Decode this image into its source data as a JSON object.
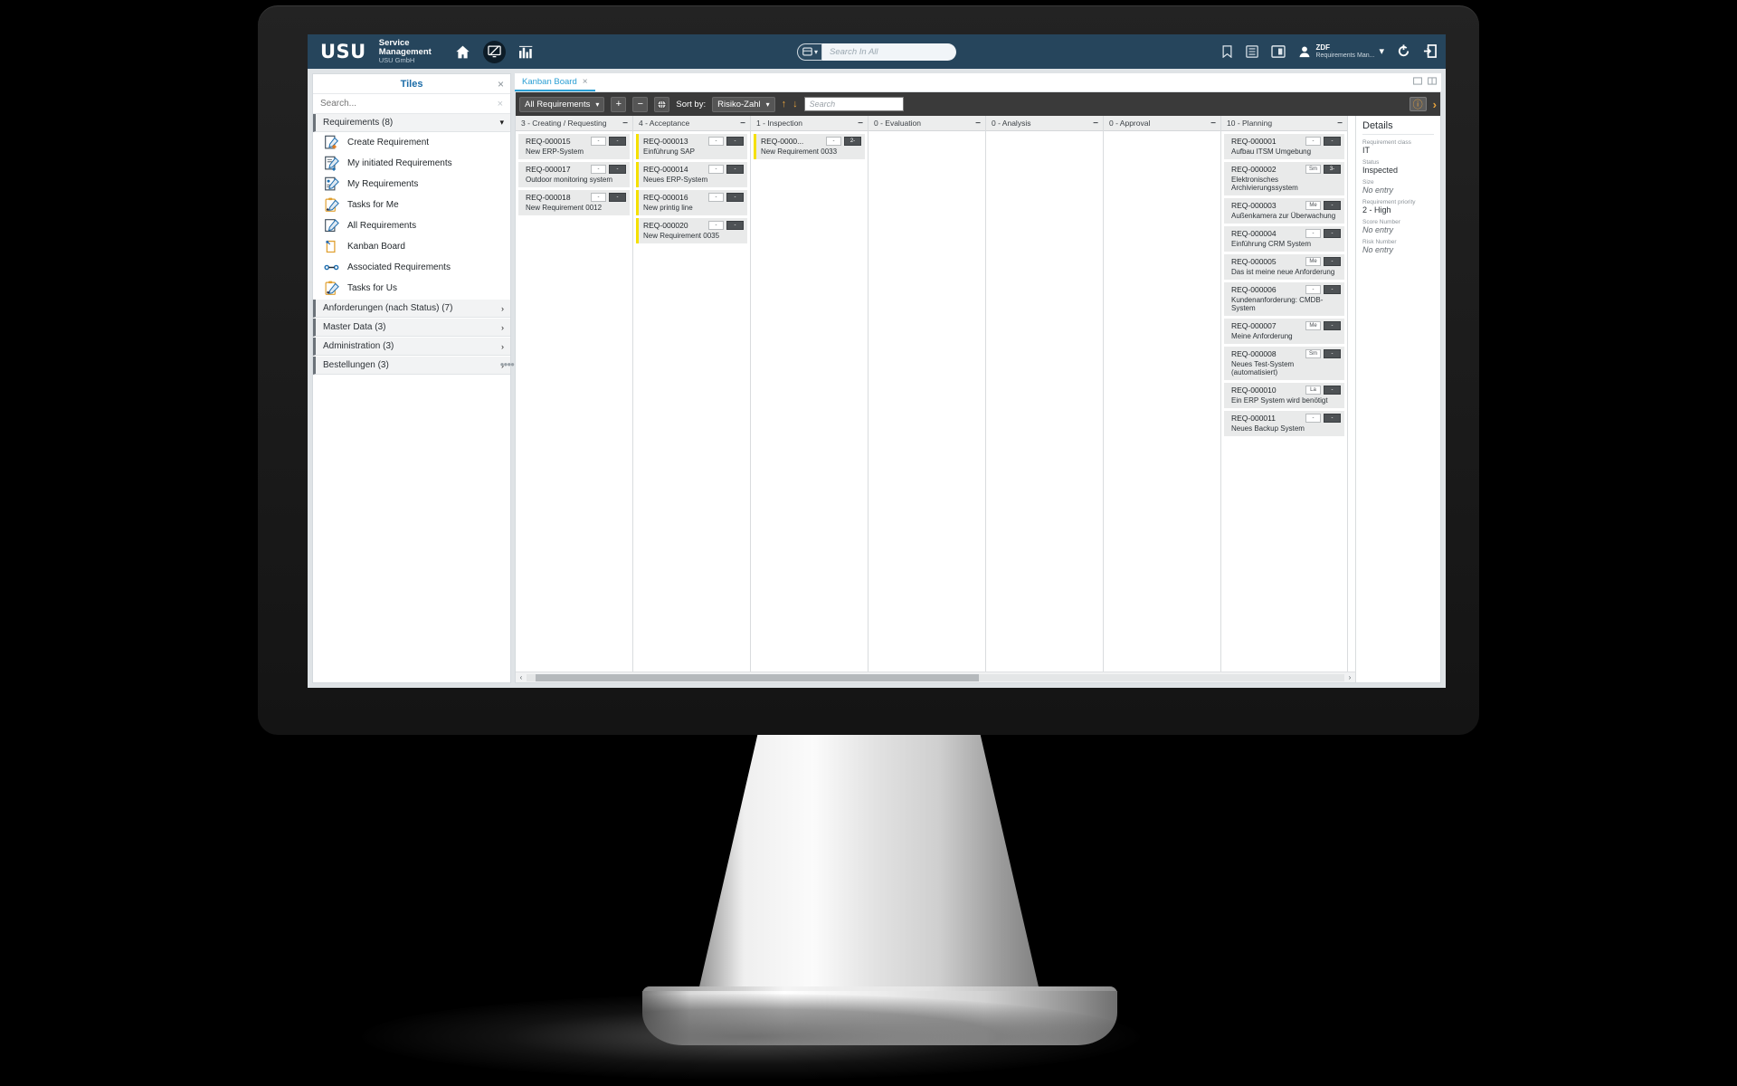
{
  "header": {
    "logo": "USU",
    "brand_line1": "Service",
    "brand_line2": "Management",
    "brand_line3": "USU GmbH",
    "icons": [
      {
        "name": "home-icon",
        "label": "Home"
      },
      {
        "name": "monitor-edit-icon",
        "label": "Workspace"
      },
      {
        "name": "bar-chart-icon",
        "label": "Analytics"
      }
    ],
    "search": {
      "placeholder": "Search In All",
      "value": "",
      "type_selector": "search-scope"
    },
    "right_icons": [
      {
        "name": "bookmark-icon",
        "label": "Bookmarks"
      },
      {
        "name": "list-icon",
        "label": "Lists"
      },
      {
        "name": "id-card-icon",
        "label": "Contact"
      }
    ],
    "user": {
      "name": "ZDF",
      "role": "Requirements Man...",
      "dropdown": "⌄"
    },
    "refresh_icon": "refresh-icon",
    "logout_icon": "logout-icon",
    "accent_color": "#26455c"
  },
  "sidebar": {
    "title": "Tiles",
    "close": "×",
    "search": {
      "placeholder": "Search...",
      "value": "",
      "clear": "×"
    },
    "group": {
      "label": "Requirements (8)",
      "chevron": "⌄"
    },
    "items": [
      {
        "label": "Create Requirement",
        "icon": "create-requirement-icon"
      },
      {
        "label": "My initiated Requirements",
        "icon": "my-initiated-requirements-icon"
      },
      {
        "label": "My Requirements",
        "icon": "my-requirements-icon"
      },
      {
        "label": "Tasks for Me",
        "icon": "tasks-for-me-icon"
      },
      {
        "label": "All Requirements",
        "icon": "all-requirements-icon"
      },
      {
        "label": "Kanban Board",
        "icon": "kanban-board-icon"
      },
      {
        "label": "Associated Requirements",
        "icon": "associated-requirements-icon"
      },
      {
        "label": "Tasks for Us",
        "icon": "tasks-for-us-icon"
      }
    ],
    "groups": [
      {
        "label": "Anforderungen (nach Status) (7)",
        "chevron": "›"
      },
      {
        "label": "Master Data (3)",
        "chevron": "›"
      },
      {
        "label": "Administration (3)",
        "chevron": "›"
      },
      {
        "label": "Bestellungen (3)",
        "chevron": "›"
      }
    ]
  },
  "tabs": [
    {
      "label": "Kanban Board",
      "close": "×",
      "active": true
    }
  ],
  "toolbar": {
    "filter_select": "All Requirements",
    "chevron": "⌄",
    "add_label": "+",
    "remove_label": "−",
    "globe_icon": "globe-icon",
    "sort_label": "Sort by:",
    "sort_select": "Risiko-Zahl",
    "sort_asc": "↑",
    "sort_desc": "↓",
    "search_placeholder": "Search",
    "search_value": "",
    "warning_icon": "warning-icon",
    "expand_chevron": "›",
    "accent_color": "#e8a33d"
  },
  "board": {
    "columns": [
      {
        "title": "3 - Creating / Requesting",
        "collapse": "−",
        "cards": [
          {
            "id": "REQ-000015",
            "title": "New ERP-System",
            "badge_light": "-",
            "badge_dark": "-",
            "highlight": false
          },
          {
            "id": "REQ-000017",
            "title": "Outdoor monitoring system",
            "badge_light": "-",
            "badge_dark": "-",
            "highlight": false
          },
          {
            "id": "REQ-000018",
            "title": "New Requirement 0012",
            "badge_light": "-",
            "badge_dark": "-",
            "highlight": false
          }
        ]
      },
      {
        "title": "4 - Acceptance",
        "collapse": "−",
        "cards": [
          {
            "id": "REQ-000013",
            "title": "Einführung SAP",
            "badge_light": "-",
            "badge_dark": "-",
            "highlight": true
          },
          {
            "id": "REQ-000014",
            "title": "Neues ERP-System",
            "badge_light": "-",
            "badge_dark": "-",
            "highlight": true
          },
          {
            "id": "REQ-000016",
            "title": "New printig line",
            "badge_light": "-",
            "badge_dark": "-",
            "highlight": true
          },
          {
            "id": "REQ-000020",
            "title": "New Requirement 0035",
            "badge_light": "-",
            "badge_dark": "-",
            "highlight": true
          }
        ]
      },
      {
        "title": "1 - Inspection",
        "collapse": "−",
        "cards": [
          {
            "id": "REQ-0000...",
            "title": "New Requirement 0033",
            "badge_light": "-",
            "badge_dark": "2-",
            "highlight": true
          }
        ]
      },
      {
        "title": "0 - Evaluation",
        "collapse": "−",
        "cards": []
      },
      {
        "title": "0 - Analysis",
        "collapse": "−",
        "cards": []
      },
      {
        "title": "0 - Approval",
        "collapse": "−",
        "cards": []
      },
      {
        "title": "10 - Planning",
        "collapse": "−",
        "cards": [
          {
            "id": "REQ-000001",
            "title": "Aufbau ITSM Umgebung",
            "badge_light": "-",
            "badge_dark": "-",
            "highlight": false
          },
          {
            "id": "REQ-000002",
            "title": "Elektronisches Archivierungssystem",
            "badge_light": "Sm",
            "badge_dark": "3-",
            "highlight": false
          },
          {
            "id": "REQ-000003",
            "title": "Außenkamera zur Überwachung",
            "badge_light": "Me",
            "badge_dark": "-",
            "highlight": false
          },
          {
            "id": "REQ-000004",
            "title": "Einführung CRM System",
            "badge_light": "-",
            "badge_dark": "-",
            "highlight": false
          },
          {
            "id": "REQ-000005",
            "title": "Das ist meine neue Anforderung",
            "badge_light": "Me",
            "badge_dark": "-",
            "highlight": false
          },
          {
            "id": "REQ-000006",
            "title": "Kundenanforderung: CMDB-System",
            "badge_light": "-",
            "badge_dark": "-",
            "highlight": false
          },
          {
            "id": "REQ-000007",
            "title": "Meine Anforderung",
            "badge_light": "Me",
            "badge_dark": "-",
            "highlight": false
          },
          {
            "id": "REQ-000008",
            "title": "Neues Test-System (automatisiert)",
            "badge_light": "Sm",
            "badge_dark": "-",
            "highlight": false
          },
          {
            "id": "REQ-000010",
            "title": "Ein ERP System wird benötigt",
            "badge_light": "La",
            "badge_dark": "-",
            "highlight": false
          },
          {
            "id": "REQ-000011",
            "title": "Neues Backup System",
            "badge_light": "-",
            "badge_dark": "-",
            "highlight": false
          }
        ]
      }
    ],
    "scroll_left": "‹",
    "scroll_right": "›"
  },
  "details": {
    "title": "Details",
    "fields": [
      {
        "label": "Requirement class",
        "value": "IT",
        "empty": false
      },
      {
        "label": "Status",
        "value": "Inspected",
        "empty": false
      },
      {
        "label": "Size",
        "value": "No entry",
        "empty": true
      },
      {
        "label": "Requirement priority",
        "value": "2 - High",
        "empty": false
      },
      {
        "label": "Score Number",
        "value": "No entry",
        "empty": true
      },
      {
        "label": "Risk Number",
        "value": "No entry",
        "empty": true
      }
    ]
  }
}
